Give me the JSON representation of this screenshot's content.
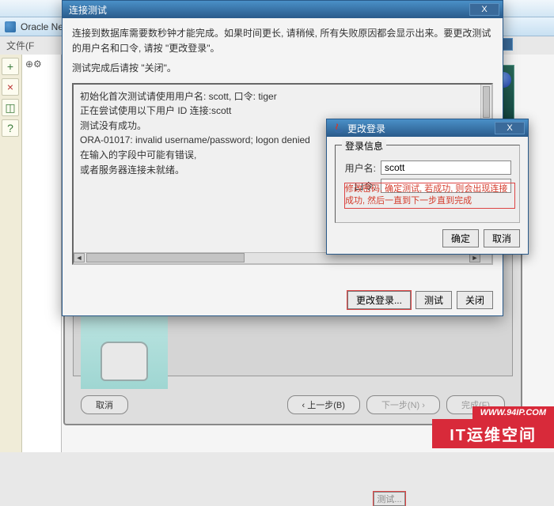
{
  "os_bar": {},
  "parent": {
    "title": "Oracle Net",
    "menu": "文件(F",
    "close_x": "X"
  },
  "toolbar": {
    "add": "+",
    "del": "×",
    "item3": "◫",
    "help": "?"
  },
  "tree": {
    "root": "⊕⚙"
  },
  "wizard": {
    "test_btn": "测试...",
    "cancel": "取消",
    "prev": "上一步(B)",
    "next": "下一步(N)",
    "finish": "完成(F)"
  },
  "dialog": {
    "title": "连接测试",
    "close": "X",
    "instr_line1": "连接到数据库需要数秒钟才能完成。如果时间更长, 请稍候, 所有失败原因都会显示出来。要更改测试的用户名和口令, 请按 \"更改登录\"。",
    "instr_line2": "测试完成后请按 \"关闭\"。",
    "log1": "初始化首次测试请使用用户名: scott, 口令: tiger",
    "log2": "正在尝试使用以下用户 ID 连接:scott",
    "log3": "测试没有成功。",
    "log4": "ORA-01017: invalid username/password; logon denied",
    "log5": "",
    "log6": "在输入的字段中可能有错误,",
    "log7": "或者服务器连接未就绪。",
    "btn_change": "更改登录...",
    "btn_test": "测试",
    "btn_close": "关闭"
  },
  "subdialog": {
    "title": "更改登录",
    "group": "登录信息",
    "user_label": "用户名:",
    "user_value": "scott",
    "pwd_label": "口令:",
    "pwd_value": "",
    "overlay": "修改密码, 确定测试, 若成功, 则会出现连接成功, 然后一直到下一步直到完成",
    "ok": "确定",
    "cancel": "取消",
    "close": "X"
  },
  "watermark": {
    "url": "WWW.94IP.COM",
    "brand": "IT运维空间"
  }
}
